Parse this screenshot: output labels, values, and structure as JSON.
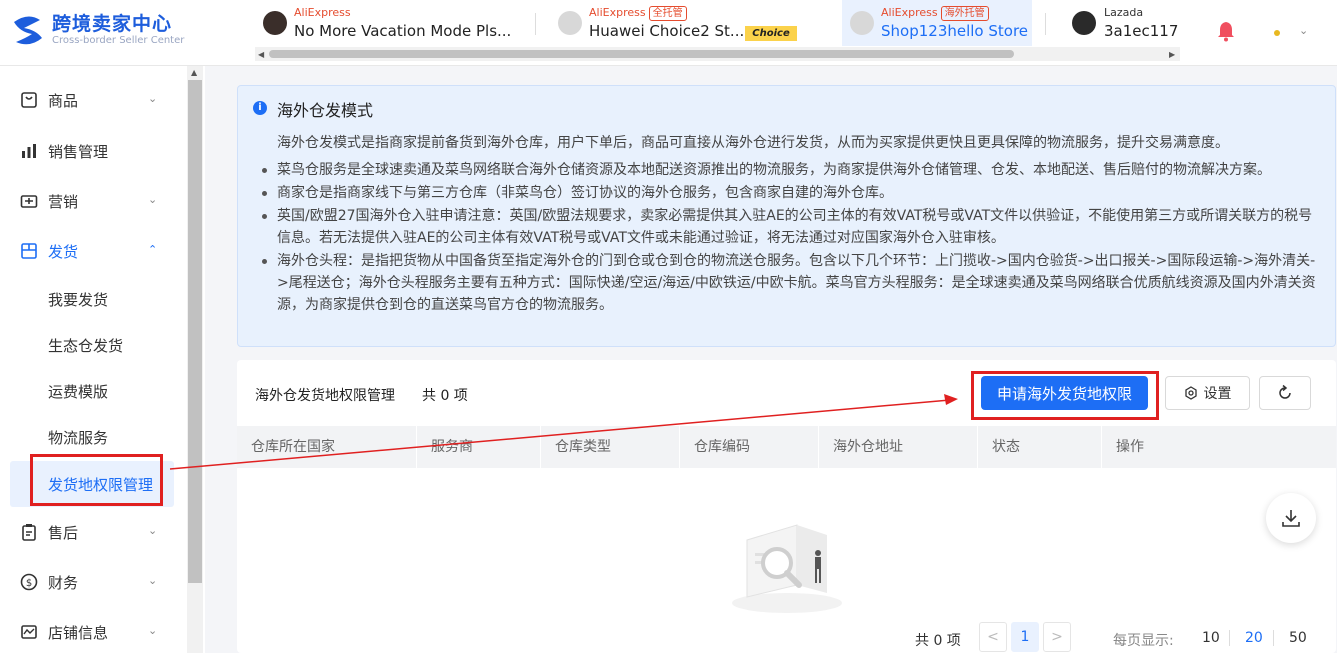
{
  "brand": {
    "title": "跨境卖家中心",
    "subtitle": "Cross-border Seller Center"
  },
  "store_tabs": [
    {
      "platform": "AliExpress",
      "tag": "",
      "name": "No More Vacation Mode Pls...",
      "badge": ""
    },
    {
      "platform": "AliExpress",
      "tag": "全托管",
      "name": "Huawei Choice2 St...",
      "badge": "Choice"
    },
    {
      "platform": "AliExpress",
      "tag": "海外托管",
      "name": "Shop123hello Store",
      "badge": ""
    },
    {
      "platform": "Lazada",
      "tag": "",
      "name": "3a1ec117",
      "badge": ""
    }
  ],
  "sidebar": {
    "items": [
      {
        "label": "商品",
        "icon": "goods-icon"
      },
      {
        "label": "销售管理",
        "icon": "chart-icon"
      },
      {
        "label": "营销",
        "icon": "marketing-icon"
      },
      {
        "label": "发货",
        "icon": "shipping-icon"
      },
      {
        "label": "售后",
        "icon": "clipboard-icon"
      },
      {
        "label": "财务",
        "icon": "dollar-icon"
      },
      {
        "label": "店铺信息",
        "icon": "store-icon"
      }
    ],
    "sub_items": [
      "我要发货",
      "生态仓发货",
      "运费模版",
      "物流服务",
      "发货地权限管理"
    ]
  },
  "info": {
    "title": "海外仓发模式",
    "intro": "海外仓发模式是指商家提前备货到海外仓库，用户下单后，商品可直接从海外仓进行发货，从而为买家提供更快且更具保障的物流服务，提升交易满意度。",
    "bullets": [
      "菜鸟仓服务是全球速卖通及菜鸟网络联合海外仓储资源及本地配送资源推出的物流服务，为商家提供海外仓储管理、仓发、本地配送、售后赔付的物流解决方案。",
      "商家仓是指商家线下与第三方仓库（非菜鸟仓）签订协议的海外仓服务，包含商家自建的海外仓库。",
      "英国/欧盟27国海外仓入驻申请注意：英国/欧盟法规要求，卖家必需提供其入驻AE的公司主体的有效VAT税号或VAT文件以供验证，不能使用第三方或所谓关联方的税号信息。若无法提供入驻AE的公司主体有效VAT税号或VAT文件或未能通过验证，将无法通过对应国家海外仓入驻审核。",
      "海外仓头程：是指把货物从中国备货至指定海外仓的门到仓或仓到仓的物流送仓服务。包含以下几个环节：上门揽收->国内仓验货->出口报关->国际段运输->海外清关->尾程送仓；海外仓头程服务主要有五种方式：国际快递/空运/海运/中欧铁运/中欧卡航。菜鸟官方头程服务：是全球速卖通及菜鸟网络联合优质航线资源及国内外清关资源，为商家提供仓到仓的直送菜鸟官方仓的物流服务。"
    ]
  },
  "panel": {
    "title": "海外仓发货地权限管理",
    "count": "共 0 项",
    "apply_button": "申请海外发货地权限",
    "settings_button": "设置",
    "columns": [
      "仓库所在国家",
      "服务商",
      "仓库类型",
      "仓库编码",
      "海外仓地址",
      "状态",
      "操作"
    ]
  },
  "pagination": {
    "total": "共 0 项",
    "prev": "<",
    "current": "1",
    "next": ">",
    "per_page_label": "每页显示:",
    "options": [
      "10",
      "20",
      "50"
    ],
    "selected": "20"
  },
  "colors": {
    "primary": "#1d6ef5",
    "highlight": "#e02020",
    "aliexpress": "#e54c2e"
  }
}
